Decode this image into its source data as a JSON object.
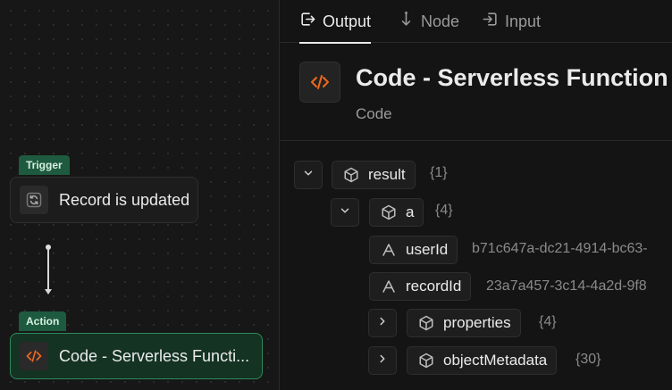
{
  "canvas": {
    "trigger": {
      "tag": "Trigger",
      "label": "Record is updated",
      "icon": "refresh-icon"
    },
    "action": {
      "tag": "Action",
      "label": "Code - Serverless Functi...",
      "icon": "code-icon"
    }
  },
  "tabs": [
    {
      "label": "Output",
      "icon": "output-icon",
      "active": true
    },
    {
      "label": "Node",
      "icon": "arrow-down-icon",
      "active": false
    },
    {
      "label": "Input",
      "icon": "input-icon",
      "active": false
    }
  ],
  "header": {
    "title": "Code - Serverless Function",
    "subtitle": "Code",
    "icon": "code-icon"
  },
  "tree": {
    "result": {
      "key": "result",
      "count": "{1}"
    },
    "a": {
      "key": "a",
      "count": "{4}"
    },
    "userId": {
      "key": "userId",
      "value": "b71c647a-dc21-4914-bc63-"
    },
    "recordId": {
      "key": "recordId",
      "value": "23a7a457-3c14-4a2d-9f8"
    },
    "properties": {
      "key": "properties",
      "count": "{4}"
    },
    "objectMetadata": {
      "key": "objectMetadata",
      "count": "{30}"
    }
  },
  "colors": {
    "accent": "#f0691e",
    "selected_border": "#2d8a5c",
    "tag_bg": "#1e5a3f"
  }
}
